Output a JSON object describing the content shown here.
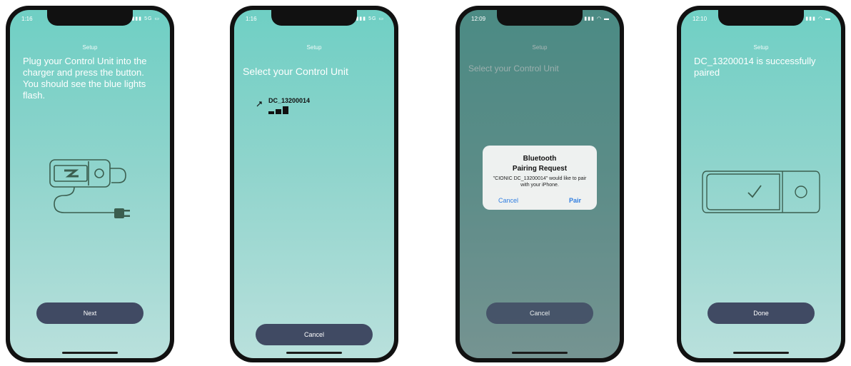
{
  "colors": {
    "screen_gradient_top": "#6fcfc4",
    "screen_gradient_bottom": "#b9e0dc",
    "button_bg": "#404a63",
    "alert_link": "#2f7de0",
    "illustration_stroke": "#3b5e4f"
  },
  "phone1": {
    "time": "1:16",
    "status_icons": "5G",
    "setup_label": "Setup",
    "headline": "Plug your Control Unit into the charger and press the button. You should see the blue lights flash.",
    "illustration_icon": "charger-plug-icon",
    "next_label": "Next"
  },
  "phone2": {
    "time": "1:16",
    "status_icons": "5G",
    "setup_label": "Setup",
    "headline": "Select your Control Unit",
    "device_name": "DC_13200014",
    "cancel_label": "Cancel"
  },
  "phone3": {
    "time": "12:09",
    "setup_label": "Setup",
    "headline": "Select your Control Unit",
    "alert_title_line1": "Bluetooth",
    "alert_title_line2": "Pairing Request",
    "alert_body": "\"CIONIC DC_13200014\" would like to pair with your iPhone.",
    "alert_cancel": "Cancel",
    "alert_pair": "Pair",
    "cancel_label": "Cancel"
  },
  "phone4": {
    "time": "12:10",
    "setup_label": "Setup",
    "headline": "DC_13200014 is successfully paired",
    "illustration_icon": "control-unit-check-icon",
    "done_label": "Done"
  }
}
